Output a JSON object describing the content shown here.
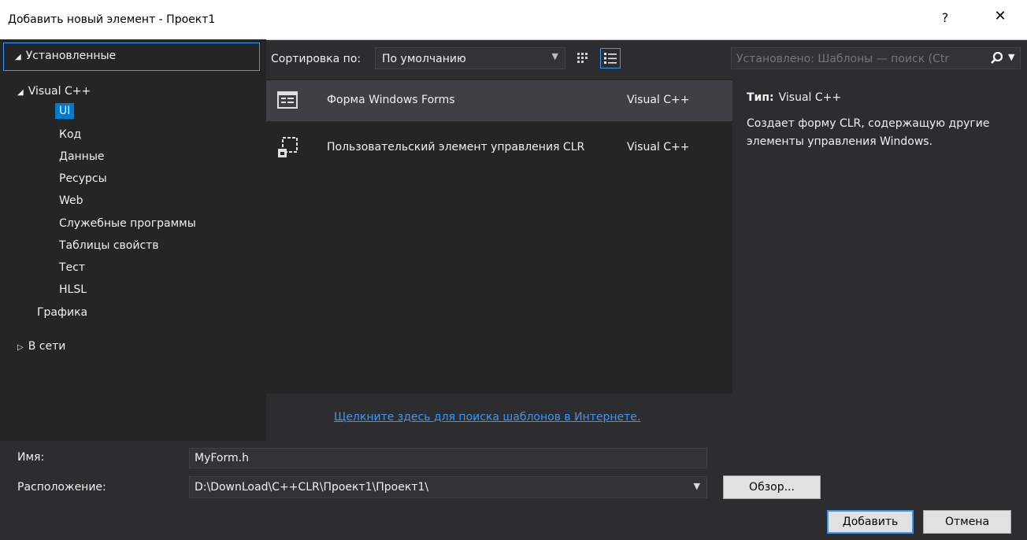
{
  "window": {
    "title": "Добавить новый элемент - Проект1",
    "help_label": "?",
    "close_label": "✕"
  },
  "left_panel": {
    "installed": "Установленные",
    "root": "Visual C++",
    "children": [
      "UI",
      "Код",
      "Данные",
      "Ресурсы",
      "Web",
      "Служебные программы",
      "Таблицы свойств",
      "Тест",
      "HLSL"
    ],
    "graphics": "Графика",
    "online": "В сети"
  },
  "toolbar": {
    "sort_label": "Сортировка по:",
    "sort_value": "По умолчанию",
    "search_placeholder": "Установлено: Шаблоны — поиск (Ctr"
  },
  "templates": [
    {
      "name": "Форма Windows Forms",
      "lang": "Visual C++"
    },
    {
      "name": "Пользовательский элемент управления CLR",
      "lang": "Visual C++"
    }
  ],
  "details": {
    "type_label": "Тип:",
    "type_value": "Visual C++",
    "description": "Создает форму CLR, содержащую другие элементы управления Windows."
  },
  "online_link": "Щелкните здесь для поиска шаблонов в Интернете.",
  "form": {
    "name_label": "Имя:",
    "name_value": "MyForm.h",
    "location_label": "Расположение:",
    "location_value": "D:\\DownLoad\\C++CLR\\Проект1\\Проект1\\"
  },
  "buttons": {
    "browse": "Обзор...",
    "add": "Добавить",
    "cancel": "Отмена"
  },
  "colors": {
    "background": "#2d2d30",
    "panel": "#252526",
    "selection": "#007acc",
    "accent": "#3399ff"
  },
  "icons": [
    "windows-form-icon",
    "user-control-icon",
    "search-icon",
    "small-icons-view-icon",
    "list-view-icon"
  ]
}
